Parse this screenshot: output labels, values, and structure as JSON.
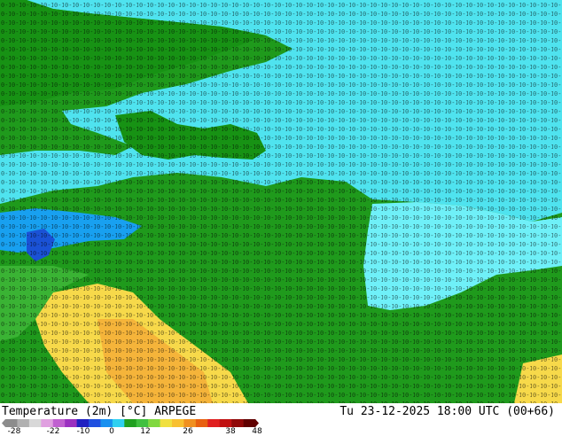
{
  "map": {
    "product_title": "Temperature (2m) [°C] ARPEGE",
    "valid_time": "Tu 23-12-2025 18:00 UTC (00+66)",
    "colors": {
      "land_green_dark": "#0a8a0a",
      "land_green": "#22a31f",
      "land_green_light": "#4dc444",
      "sea_cyan": "#4fe3ef",
      "sea_cyan_light": "#6ff0f8",
      "cold_blue": "#18a0f0",
      "very_cold_blue": "#1a52d6",
      "warm_yellow": "#f7d94a",
      "warm_orange": "#f5b43a",
      "number_color": "#000000"
    }
  },
  "colorbar": {
    "tick_labels": [
      "-28",
      "-22",
      "-10",
      "0",
      "12",
      "26",
      "38",
      "48"
    ],
    "segments": [
      "#8c8c8c",
      "#b0b0b0",
      "#d8d8d8",
      "#e0a0e0",
      "#c060d0",
      "#9b30c0",
      "#2020c0",
      "#2050e0",
      "#1890f0",
      "#30d0f0",
      "#20a020",
      "#40c040",
      "#80d840",
      "#f0e040",
      "#f8c030",
      "#f09020",
      "#e86010",
      "#e02020",
      "#c01010",
      "#900808",
      "#600000"
    ]
  }
}
